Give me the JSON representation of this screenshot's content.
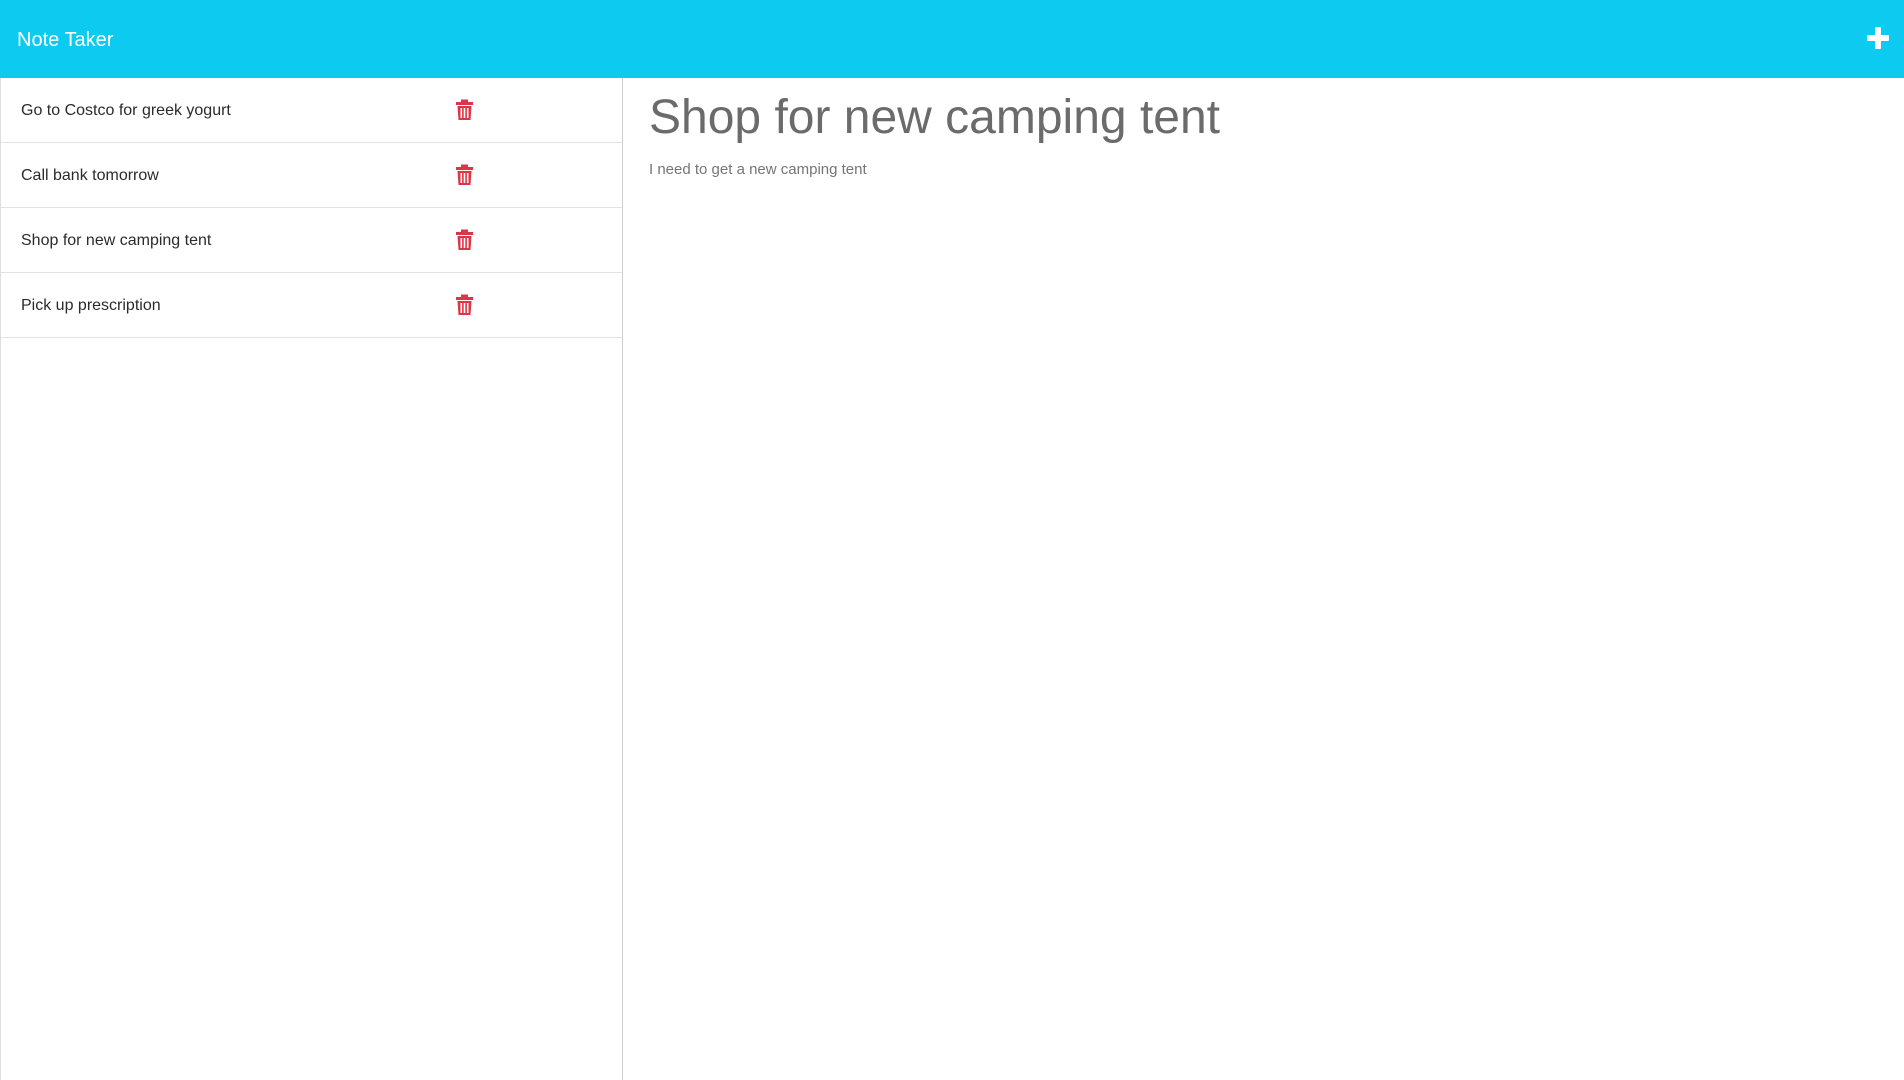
{
  "navbar": {
    "title": "Note Taker",
    "new_note_icon": "plus-icon",
    "background": "#0dcaf0"
  },
  "notes": [
    {
      "title": "Go to Costco for greek yogurt"
    },
    {
      "title": "Call bank tomorrow"
    },
    {
      "title": "Shop for new camping tent"
    },
    {
      "title": "Pick up prescription"
    }
  ],
  "delete_icon": "trash-icon",
  "delete_color": "#dc3545",
  "active_note": {
    "title": "Shop for new camping tent",
    "text": "I need to get a new camping tent"
  }
}
